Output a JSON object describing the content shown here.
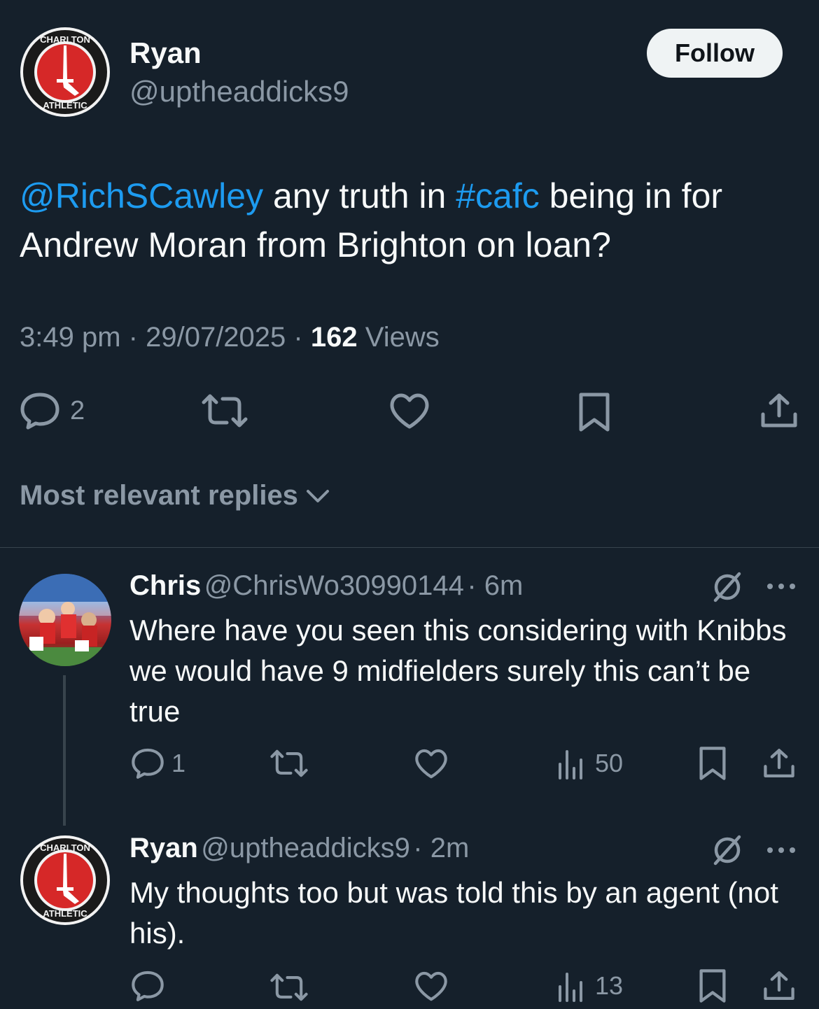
{
  "main_tweet": {
    "author_name": "Ryan",
    "author_handle": "@uptheaddicks9",
    "follow_label": "Follow",
    "text_mention": "@RichSCawley",
    "text_part1": " any truth in ",
    "text_hashtag": "#cafc",
    "text_part2": " being in for Andrew Moran from Brighton on loan?",
    "time": "3:49 pm",
    "date": "29/07/2025",
    "views_count": "162",
    "views_label": "Views",
    "reply_count": "2"
  },
  "crest": {
    "top_text": "CHARLTON",
    "bottom_text": "ATHLETIC"
  },
  "replies_sort_label": "Most relevant replies",
  "replies": [
    {
      "author_name": "Chris",
      "author_handle": "@ChrisWo30990144",
      "time": "6m",
      "text": "Where have you seen this considering with Knibbs we would have 9 midfielders surely this can’t be true",
      "reply_count": "1",
      "views_count": "50"
    },
    {
      "author_name": "Ryan",
      "author_handle": "@uptheaddicks9",
      "time": "2m",
      "text": "My thoughts too but was told this by an agent (not his).",
      "views_count": "13"
    }
  ],
  "colors": {
    "background": "#15202b",
    "accent": "#1d9bf0",
    "muted": "#8b98a5",
    "crest_red": "#d62828"
  }
}
